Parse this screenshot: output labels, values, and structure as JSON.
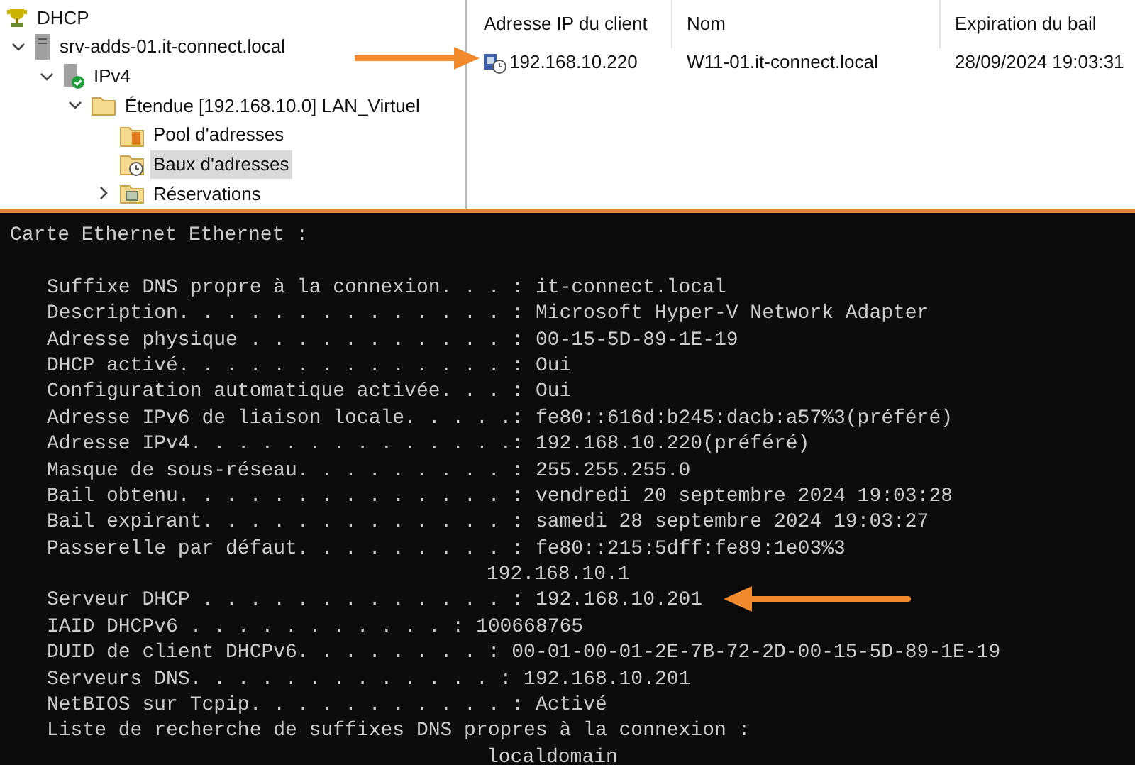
{
  "tree": [
    {
      "label": "DHCP",
      "kind": "dhcp",
      "selected": false,
      "children": [
        {
          "label": "srv-adds-01.it-connect.local",
          "kind": "server",
          "expanded": true,
          "selected": false,
          "children": [
            {
              "label": "IPv4",
              "kind": "ipv4",
              "expanded": true,
              "selected": false,
              "children": [
                {
                  "label": "Étendue [192.168.10.0] LAN_Virtuel",
                  "kind": "folder",
                  "expanded": true,
                  "selected": false,
                  "children": [
                    {
                      "label": "Pool d'adresses",
                      "kind": "pool",
                      "selected": false
                    },
                    {
                      "label": "Baux d'adresses",
                      "kind": "leases",
                      "selected": true
                    },
                    {
                      "label": "Réservations",
                      "kind": "reservations",
                      "expanded": false,
                      "selected": false
                    }
                  ]
                }
              ]
            }
          ]
        }
      ]
    }
  ],
  "leases": {
    "columns": [
      "Adresse IP du client",
      "Nom",
      "Expiration du bail"
    ],
    "rows": [
      [
        "192.168.10.220",
        "W11-01.it-connect.local",
        "28/09/2024 19:03:31"
      ]
    ]
  },
  "terminal": [
    {
      "kind": "heading",
      "text": "Carte Ethernet Ethernet :"
    },
    {
      "kind": "blank"
    },
    {
      "kind": "entry",
      "text": "Suffixe DNS propre à la connexion. . . : it-connect.local"
    },
    {
      "kind": "entry",
      "text": "Description. . . . . . . . . . . . . . : Microsoft Hyper-V Network Adapter"
    },
    {
      "kind": "entry",
      "text": "Adresse physique . . . . . . . . . . . : 00-15-5D-89-1E-19"
    },
    {
      "kind": "entry",
      "text": "DHCP activé. . . . . . . . . . . . . . : Oui"
    },
    {
      "kind": "entry",
      "text": "Configuration automatique activée. . . : Oui"
    },
    {
      "kind": "entry",
      "text": "Adresse IPv6 de liaison locale. . . . .: fe80::616d:b245:dacb:a57%3(préféré)"
    },
    {
      "kind": "entry",
      "text": "Adresse IPv4. . . . . . . . . . . . . .: 192.168.10.220(préféré)"
    },
    {
      "kind": "entry",
      "text": "Masque de sous-réseau. . . . . . . . . : 255.255.255.0"
    },
    {
      "kind": "entry",
      "text": "Bail obtenu. . . . . . . . . . . . . . : vendredi 20 septembre 2024 19:03:28"
    },
    {
      "kind": "entry",
      "text": "Bail expirant. . . . . . . . . . . . . : samedi 28 septembre 2024 19:03:27"
    },
    {
      "kind": "entry",
      "text": "Passerelle par défaut. . . . . . . . . : fe80::215:5dff:fe89:1e03%3"
    },
    {
      "kind": "continuation",
      "text": "192.168.10.1"
    },
    {
      "kind": "entry",
      "text": "Serveur DHCP . . . . . . . . . . . . . : 192.168.10.201"
    },
    {
      "kind": "entry",
      "text": "IAID DHCPv6 . . . . . . . . . . . : 100668765"
    },
    {
      "kind": "entry",
      "text": "DUID de client DHCPv6. . . . . . . . : 00-01-00-01-2E-7B-72-2D-00-15-5D-89-1E-19"
    },
    {
      "kind": "entry",
      "text": "Serveurs DNS. . . . . . . . . . . . . : 192.168.10.201"
    },
    {
      "kind": "entry",
      "text": "NetBIOS sur Tcpip. . . . . . . . . . . : Activé"
    },
    {
      "kind": "entry",
      "text": "Liste de recherche de suffixes DNS propres à la connexion :"
    },
    {
      "kind": "continuation",
      "text": "localdomain"
    }
  ]
}
